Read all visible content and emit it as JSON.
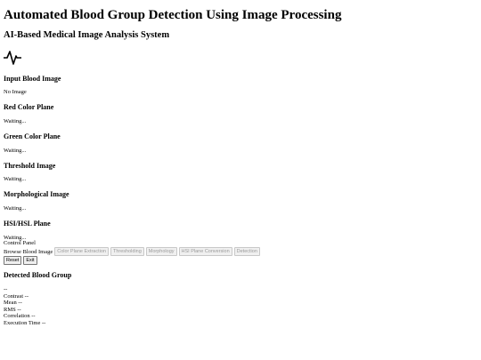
{
  "header": {
    "title": "Automated Blood Group Detection Using Image Processing",
    "subtitle": "AI-Based Medical Image Analysis System",
    "logo_icon": "pulse-icon"
  },
  "panels": [
    {
      "heading": "Input Blood Image",
      "status": "No Image"
    },
    {
      "heading": "Red Color Plane",
      "status": "Waiting..."
    },
    {
      "heading": "Green Color Plane",
      "status": "Waiting..."
    },
    {
      "heading": "Threshold Image",
      "status": "Waiting..."
    },
    {
      "heading": "Morphological Image",
      "status": "Waiting..."
    },
    {
      "heading": "HSI/HSL Plane",
      "status": "Waiting..."
    }
  ],
  "control_panel": {
    "title": "Control Panel",
    "browse_label": "Browse Blood Image",
    "buttons": [
      "Color Plane Extraction",
      "Thresholding",
      "Morphology",
      "HSI Plane Conversion",
      "Detection"
    ],
    "reset_label": "Reset",
    "exit_label": "Exit"
  },
  "result": {
    "heading": "Detected Blood Group",
    "value": "--",
    "metrics": [
      "Contrast --",
      "Mean --",
      "RMS --",
      "Correlation --",
      "Execution Time --"
    ]
  }
}
